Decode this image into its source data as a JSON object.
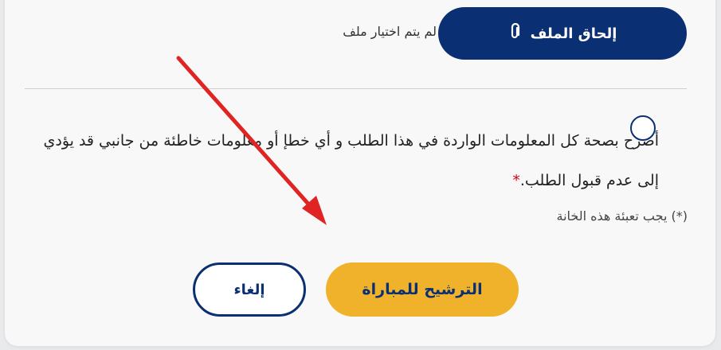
{
  "upload": {
    "attach_label": "إلحاق الملف",
    "attach_icon": "paperclip-icon",
    "status_text": "لم يتم اختيار ملف"
  },
  "declaration": {
    "text": "أصرح بصحة كل المعلومات الواردة في هذا الطلب و أي خطإ أو معلومات خاطئة من جانبي قد يؤدي إلى عدم قبول الطلب.",
    "required_mark": "*"
  },
  "required_note": {
    "mark": "(*)",
    "text": "يجب تعبئة هذه الخانة"
  },
  "actions": {
    "nominate_label": "الترشيح للمباراة",
    "cancel_label": "إلغاء"
  },
  "colors": {
    "primary": "#0b2f73",
    "accent": "#f0b22a",
    "required": "#d0021b",
    "annotation_arrow": "#e02424"
  }
}
